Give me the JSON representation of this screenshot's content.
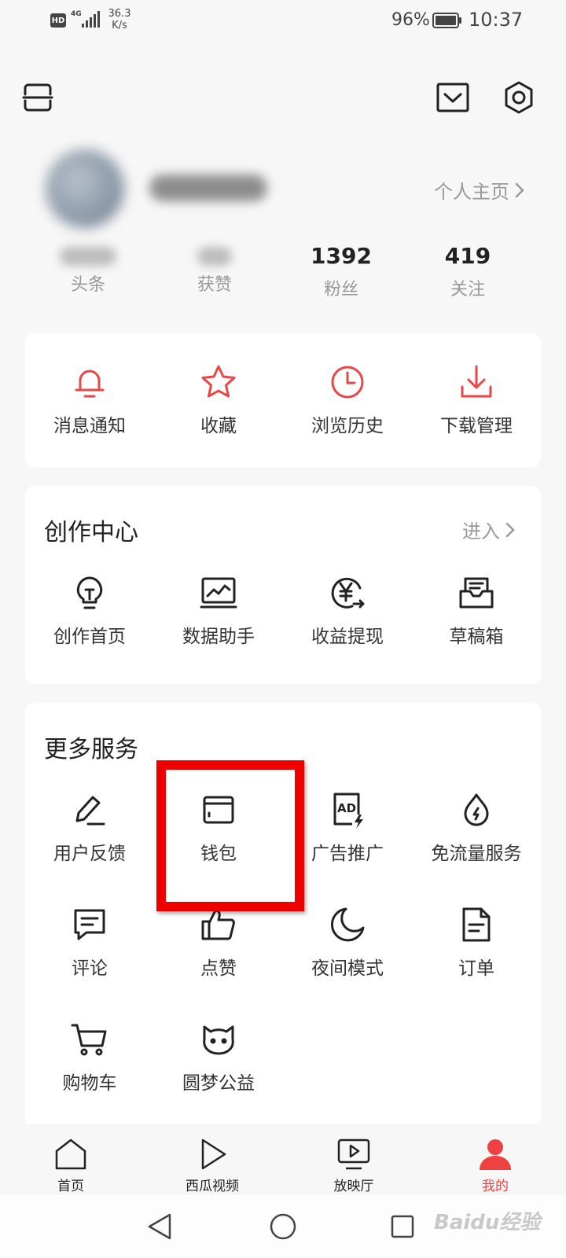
{
  "status_bar": {
    "hd": "HD",
    "network": "4G",
    "speed_value": "36.3",
    "speed_unit": "K/s",
    "battery": "96%",
    "time": "10:37"
  },
  "header": {
    "scan_icon": "scan-icon",
    "mail_icon": "mail-icon",
    "settings_icon": "gear-icon"
  },
  "profile": {
    "homepage_link": "个人主页",
    "stats": [
      {
        "value": "",
        "label": "头条"
      },
      {
        "value": "",
        "label": "获赞"
      },
      {
        "value": "1392",
        "label": "粉丝"
      },
      {
        "value": "419",
        "label": "关注"
      }
    ]
  },
  "quick_actions": [
    {
      "label": "消息通知",
      "icon": "bell-icon"
    },
    {
      "label": "收藏",
      "icon": "star-icon"
    },
    {
      "label": "浏览历史",
      "icon": "clock-icon"
    },
    {
      "label": "下载管理",
      "icon": "download-icon"
    }
  ],
  "creation_center": {
    "title": "创作中心",
    "enter": "进入",
    "items": [
      {
        "label": "创作首页",
        "icon": "lightbulb-icon"
      },
      {
        "label": "数据助手",
        "icon": "chart-monitor-icon"
      },
      {
        "label": "收益提现",
        "icon": "yen-icon"
      },
      {
        "label": "草稿箱",
        "icon": "draft-box-icon"
      }
    ]
  },
  "more_services": {
    "title": "更多服务",
    "items": [
      {
        "label": "用户反馈",
        "icon": "pen-icon"
      },
      {
        "label": "钱包",
        "icon": "wallet-icon"
      },
      {
        "label": "广告推广",
        "icon": "ad-icon"
      },
      {
        "label": "免流量服务",
        "icon": "drop-icon"
      },
      {
        "label": "评论",
        "icon": "comment-icon"
      },
      {
        "label": "点赞",
        "icon": "thumb-up-icon"
      },
      {
        "label": "夜间模式",
        "icon": "moon-icon"
      },
      {
        "label": "订单",
        "icon": "document-icon"
      },
      {
        "label": "购物车",
        "icon": "cart-icon"
      },
      {
        "label": "圆梦公益",
        "icon": "cat-face-icon"
      }
    ]
  },
  "bottom_nav": [
    {
      "label": "首页",
      "icon": "home-icon"
    },
    {
      "label": "西瓜视频",
      "icon": "play-icon"
    },
    {
      "label": "放映厅",
      "icon": "tv-icon"
    },
    {
      "label": "我的",
      "icon": "person-icon",
      "active": true
    }
  ],
  "colors": {
    "accent_red": "#f04142",
    "highlight_red": "#ee0000"
  },
  "watermark": "Baidu经验"
}
